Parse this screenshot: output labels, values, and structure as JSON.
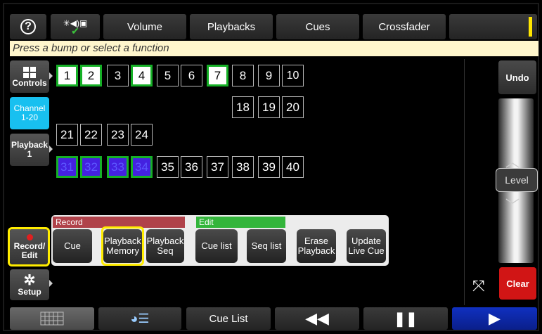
{
  "topbar": {
    "help_icon": "?",
    "tabs": [
      {
        "label": "Volume"
      },
      {
        "label": "Playbacks"
      },
      {
        "label": "Cues"
      },
      {
        "label": "Crossfader"
      }
    ]
  },
  "prompt": "Press a bump or select a function",
  "sidebar": {
    "controls": "Controls",
    "channel_line1": "Channel",
    "channel_line2": "1-20",
    "playback_line1": "Playback",
    "playback_line2": "1",
    "record_line1": "Record/",
    "record_line2": "Edit",
    "setup": "Setup"
  },
  "channels": {
    "row1": [
      "1",
      "2",
      "3",
      "4",
      "5",
      "6",
      "7",
      "8",
      "9",
      "10"
    ],
    "row2": [
      "18",
      "19",
      "20"
    ],
    "row3": [
      "21",
      "22",
      "23",
      "24"
    ],
    "row4": [
      "31",
      "32",
      "33",
      "34",
      "35",
      "36",
      "37",
      "38",
      "39",
      "40"
    ]
  },
  "right": {
    "undo": "Undo",
    "level": "Level",
    "clear": "Clear"
  },
  "popup": {
    "record_group": "Record",
    "edit_group": "Edit",
    "buttons": {
      "cue": "Cue",
      "pb_mem_1": "Playback",
      "pb_mem_2": "Memory",
      "pb_seq_1": "Playback",
      "pb_seq_2": "Seq",
      "cue_list": "Cue list",
      "seq_list": "Seq list",
      "erase_1": "Erase",
      "erase_2": "Playback",
      "update_1": "Update",
      "update_2": "Live Cue"
    },
    "colors": {
      "record": "#b0424a",
      "edit": "#33b53b"
    }
  },
  "bottombar": {
    "cue_list": "Cue List"
  }
}
